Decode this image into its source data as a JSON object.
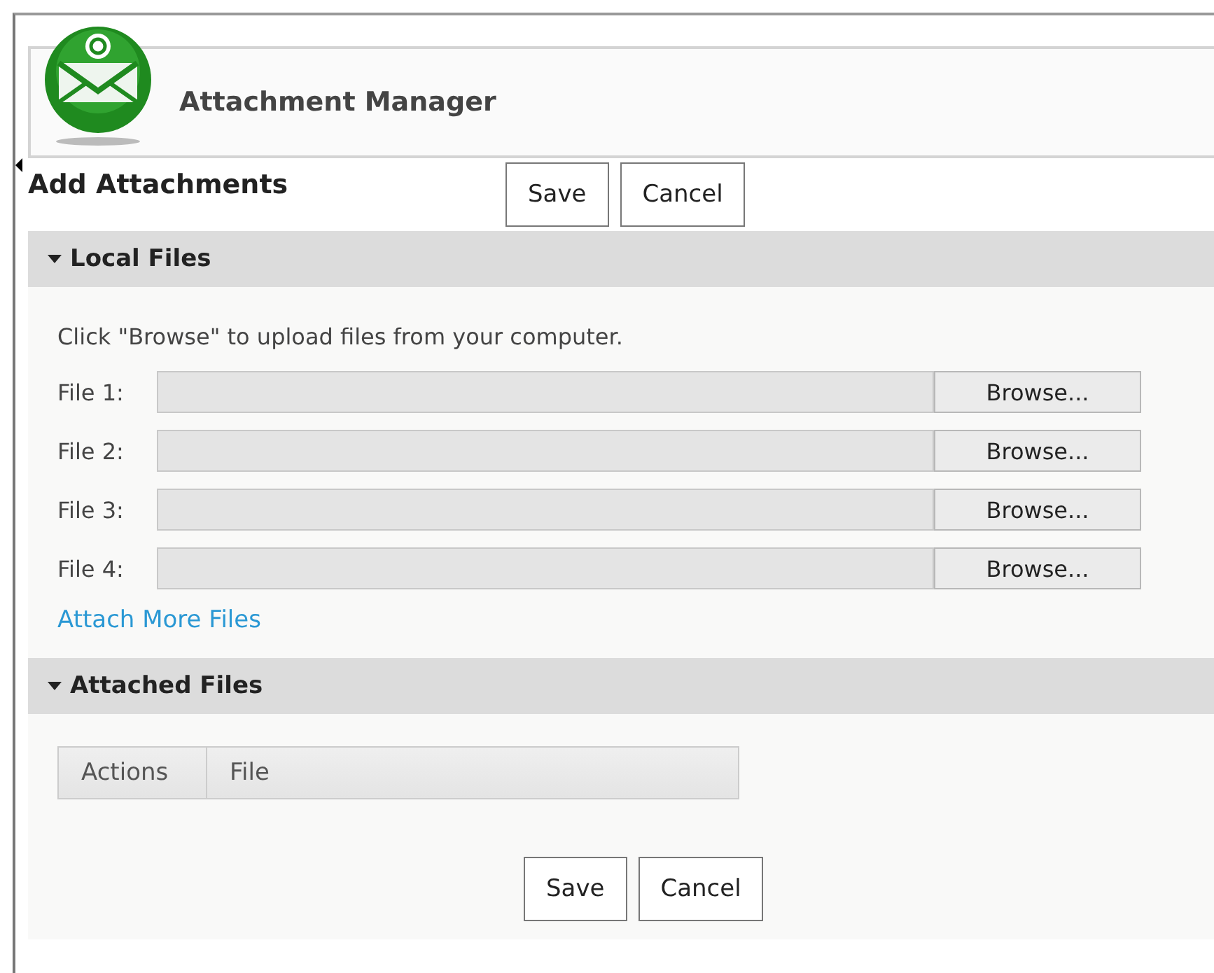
{
  "header": {
    "title": "Attachment Manager"
  },
  "page_title": "Add Attachments",
  "top_buttons": [
    "Save",
    "Cancel"
  ],
  "local_files": {
    "heading": "Local Files",
    "expanded": true,
    "instructions": "Click \"Browse\" to upload files from your computer.",
    "files": [
      {
        "label": "File 1:",
        "button": "Browse..."
      },
      {
        "label": "File 2:",
        "button": "Browse..."
      },
      {
        "label": "File 3:",
        "button": "Browse..."
      },
      {
        "label": "File 4:",
        "button": "Browse..."
      }
    ],
    "more_link": "Attach More Files"
  },
  "attached_files": {
    "heading": "Attached Files",
    "expanded": true,
    "columns": [
      "Actions",
      "File"
    ]
  },
  "bottom_buttons": [
    "Save",
    "Cancel"
  ]
}
